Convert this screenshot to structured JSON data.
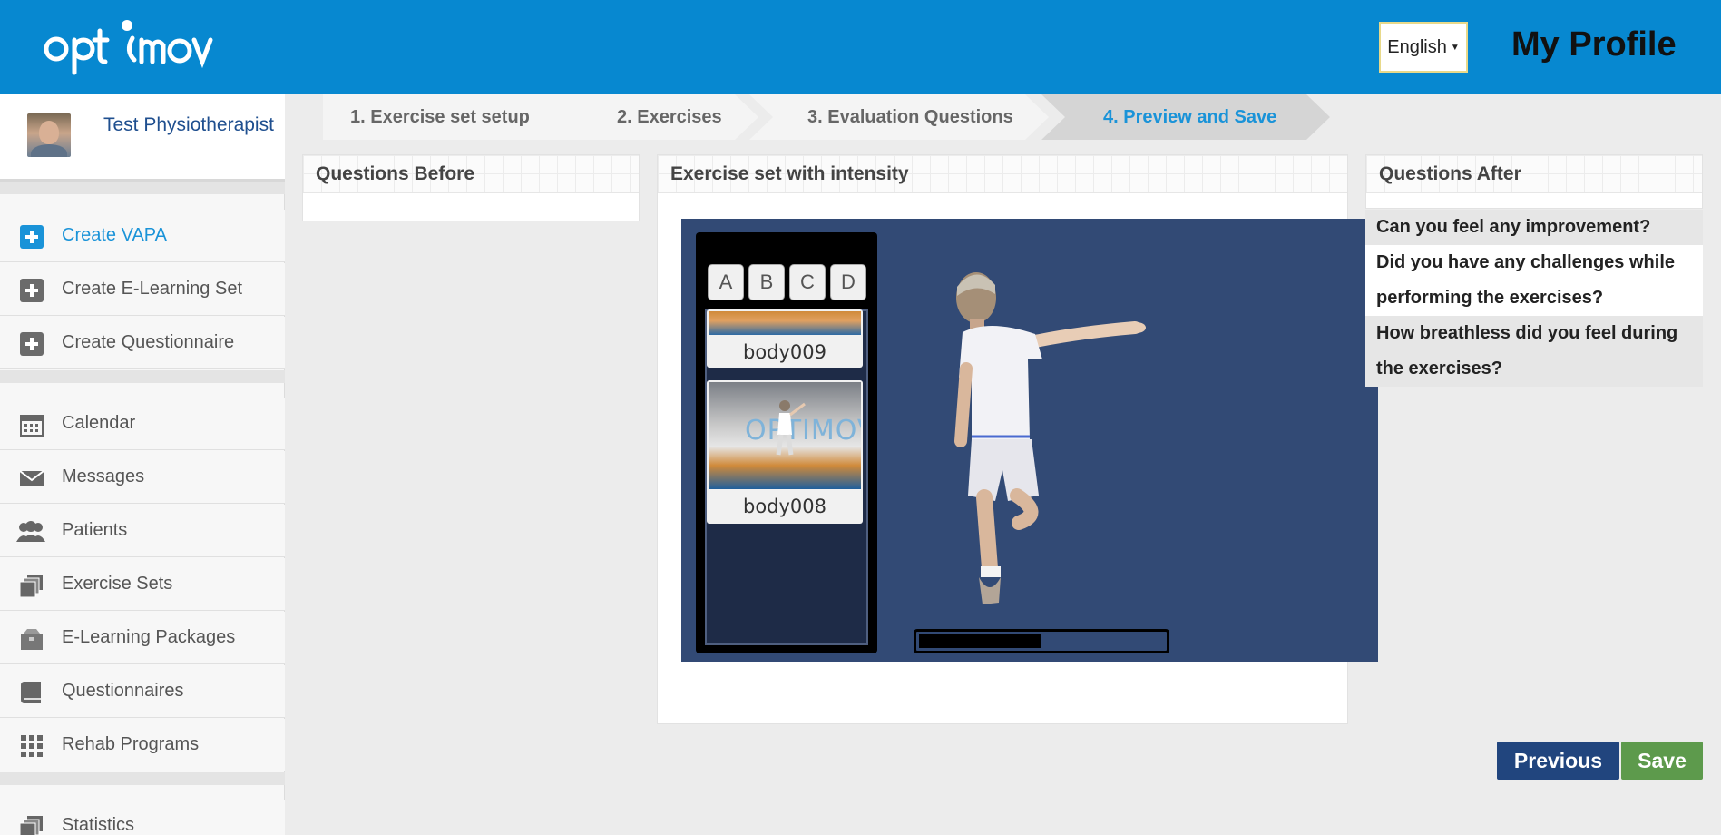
{
  "header": {
    "logo_text": "optimov",
    "language": "English",
    "title": "My Profile"
  },
  "user": {
    "name": "Test Physiotherapist"
  },
  "sidebar": {
    "items": [
      {
        "label": "Create VAPA",
        "icon": "plus-square-icon",
        "active": true
      },
      {
        "label": "Create E-Learning Set",
        "icon": "plus-square-icon"
      },
      {
        "label": "Create Questionnaire",
        "icon": "plus-square-icon"
      },
      {
        "label": "Calendar",
        "icon": "calendar-icon"
      },
      {
        "label": "Messages",
        "icon": "envelope-icon"
      },
      {
        "label": "Patients",
        "icon": "users-icon"
      },
      {
        "label": "Exercise Sets",
        "icon": "stacked-pages-icon"
      },
      {
        "label": "E-Learning Packages",
        "icon": "package-icon"
      },
      {
        "label": "Questionnaires",
        "icon": "book-icon"
      },
      {
        "label": "Rehab Programs",
        "icon": "grid-icon"
      },
      {
        "label": "Statistics",
        "icon": "stacked-pages-icon"
      }
    ]
  },
  "steps": [
    {
      "label": "1. Exercise set setup"
    },
    {
      "label": "2. Exercises"
    },
    {
      "label": "3. Evaluation Questions"
    },
    {
      "label": "4. Preview and Save",
      "active": true
    }
  ],
  "panels": {
    "before_title": "Questions Before",
    "exercise_title": "Exercise set with intensity",
    "after_title": "Questions After"
  },
  "player": {
    "tabs": [
      "A",
      "B",
      "C",
      "D"
    ],
    "thumbnails": [
      {
        "label": "body009"
      },
      {
        "label": "body008"
      }
    ],
    "thumb_watermark": "OPTIMOV",
    "progress": 0.5
  },
  "questions_after": [
    "Can you feel any improvement?",
    "Did you have any challenges while performing the exercises?",
    "How breathless did you feel during the exercises?"
  ],
  "buttons": {
    "previous": "Previous",
    "save": "Save"
  },
  "colors": {
    "header": "#0788d0",
    "accent": "#1a93d8",
    "previous_button": "#21457e",
    "save_button": "#5d9a4c",
    "player_bg": "#324a75"
  }
}
